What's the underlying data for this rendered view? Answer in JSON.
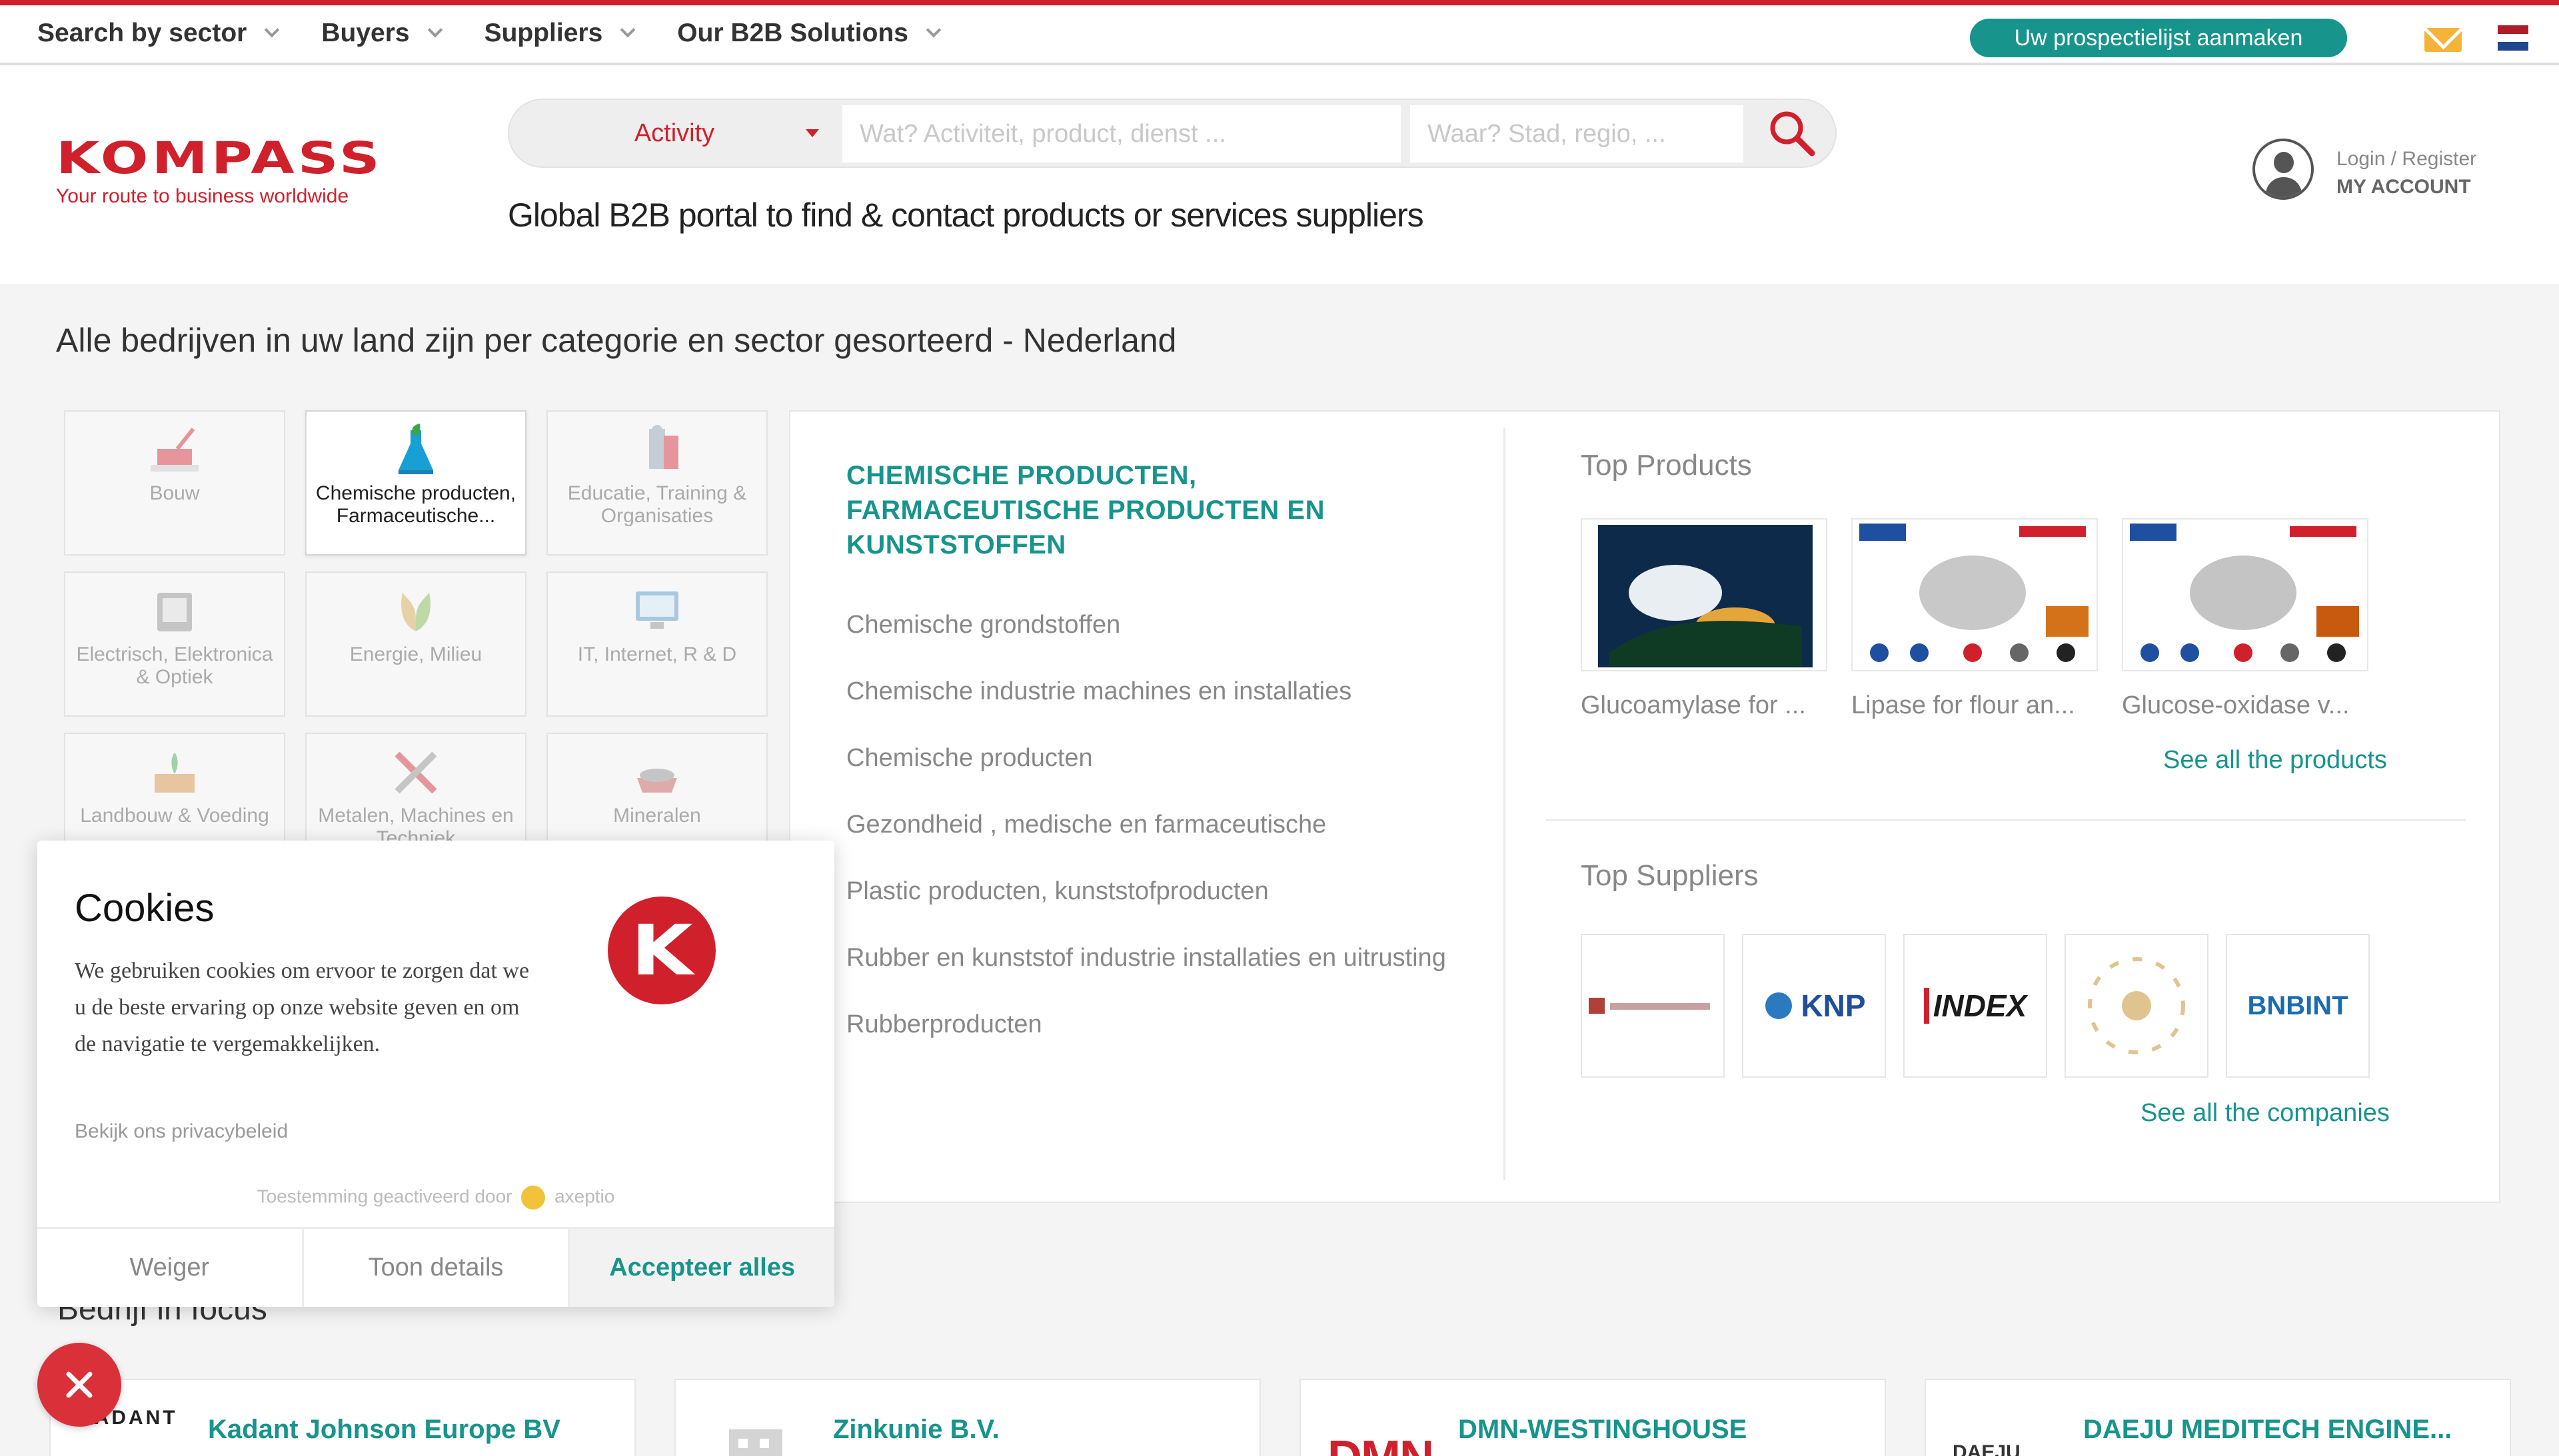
{
  "topnav": {
    "items": [
      {
        "label": "Search by sector"
      },
      {
        "label": "Buyers"
      },
      {
        "label": "Suppliers"
      },
      {
        "label": "Our B2B Solutions"
      }
    ],
    "prospect_button": "Uw prospectielijst aanmaken",
    "icons": {
      "mail": "mail-icon",
      "language": "netherlands-flag-icon"
    }
  },
  "header": {
    "logo_text": "KOMPASS",
    "logo_tagline": "Your route to business worldwide",
    "search": {
      "activity_label": "Activity",
      "what_placeholder": "Wat? Activiteit, product, dienst ...",
      "where_placeholder": "Waar? Stad, regio, ...",
      "icon": "search-icon"
    },
    "tagline": "Global B2B portal to find & contact products or services suppliers",
    "account": {
      "login": "Login / Register",
      "my_account": "MY ACCOUNT",
      "icon": "user-icon"
    }
  },
  "main": {
    "section_title": "Alle bedrijven in uw land zijn per categorie en sector gesorteerd - Nederland",
    "sectors": [
      {
        "label": "Bouw",
        "icon": "construction-icon"
      },
      {
        "label": "Chemische producten, Farmaceutische...",
        "icon": "chemistry-flask-icon",
        "active": true
      },
      {
        "label": "Educatie, Training & Organisaties",
        "icon": "education-icon"
      },
      {
        "label": "Electrisch, Elektronica & Optiek",
        "icon": "electronics-icon"
      },
      {
        "label": "Energie, Milieu",
        "icon": "energy-icon"
      },
      {
        "label": "IT, Internet, R & D",
        "icon": "computer-icon"
      },
      {
        "label": "Landbouw & Voeding",
        "icon": "agriculture-icon"
      },
      {
        "label": "Metalen, Machines en Techniek",
        "icon": "tools-icon"
      },
      {
        "label": "Mineralen",
        "icon": "minerals-icon"
      }
    ],
    "category_title": "CHEMISCHE PRODUCTEN, FARMACEUTISCHE PRODUCTEN EN KUNSTSTOFFEN",
    "subcategories": [
      "Chemische grondstoffen",
      "Chemische industrie machines en installaties",
      "Chemische producten",
      "Gezondheid , medische en farmaceutische",
      "Plastic producten, kunststofproducten",
      "Rubber en kunststof industrie installaties en uitrusting",
      "Rubberproducten"
    ],
    "top_products": {
      "title": "Top Products",
      "items": [
        {
          "name": "Glucoamylase for ..."
        },
        {
          "name": "Lipase for flour an..."
        },
        {
          "name": "Glucose-oxidase v..."
        }
      ],
      "see_all": "See all the products"
    },
    "top_suppliers": {
      "title": "Top Suppliers",
      "items": [
        {
          "name": "",
          "icon": "supplier-logo-1"
        },
        {
          "name": "KNP",
          "icon": "knp-logo"
        },
        {
          "name": "INDEX",
          "icon": "index-logo"
        },
        {
          "name": "",
          "icon": "supplier-logo-4"
        },
        {
          "name": "BNBINT",
          "icon": "bnbint-logo"
        }
      ],
      "see_all": "See all the companies"
    },
    "focus": {
      "title": "Bedrijf in focus",
      "companies": [
        {
          "name": "Kadant Johnson Europe BV",
          "logo_text": "KADANT"
        },
        {
          "name": "Zinkunie B.V.",
          "logo_text": ""
        },
        {
          "name": "DMN-WESTINGHOUSE",
          "logo_text": "DMN"
        },
        {
          "name": "DAEJU MEDITECH ENGINE...",
          "logo_text": "DAEJU"
        }
      ]
    }
  },
  "cookies": {
    "title": "Cookies",
    "text": "We gebruiken cookies om ervoor te zorgen dat we u de beste ervaring op onze website geven en om de navigatie te vergemakkelijken.",
    "privacy_link": "Bekijk ons privacybeleid",
    "powered_prefix": "Toestemming geactiveerd door",
    "powered_brand": "axeptio",
    "buttons": {
      "reject": "Weiger",
      "details": "Toon details",
      "accept": "Accepteer alles"
    },
    "logo_letter": "K"
  },
  "colors": {
    "brand_red": "#d0202c",
    "teal": "#17948c"
  }
}
